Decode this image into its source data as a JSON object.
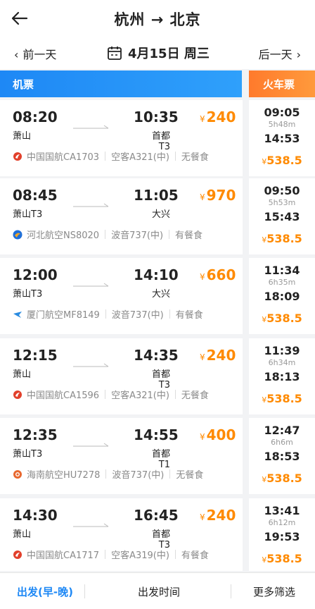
{
  "header": {
    "title": "杭州 → 北京"
  },
  "datebar": {
    "prev_label": "前一天",
    "date_label": "4月15日 周三",
    "next_label": "后一天"
  },
  "tabs": {
    "flight_label": "机票",
    "train_label": "火车票"
  },
  "rows": [
    {
      "flight": {
        "dep_time": "08:20",
        "arr_time": "10:35",
        "dep_airport": "萧山",
        "arr_airport": "首都T3",
        "price": "240",
        "airline_icon": "air-china-icon",
        "airline": "中国国航CA1703",
        "aircraft": "空客A321(中)",
        "meal": "无餐食"
      },
      "train": {
        "dep_time": "09:05",
        "duration": "5h48m",
        "arr_time": "14:53",
        "price": "538.5"
      }
    },
    {
      "flight": {
        "dep_time": "08:45",
        "arr_time": "11:05",
        "dep_airport": "萧山T3",
        "arr_airport": "大兴",
        "price": "970",
        "airline_icon": "hebei-airlines-icon",
        "airline": "河北航空NS8020",
        "aircraft": "波音737(中)",
        "meal": "有餐食"
      },
      "train": {
        "dep_time": "09:50",
        "duration": "5h53m",
        "arr_time": "15:43",
        "price": "538.5"
      }
    },
    {
      "flight": {
        "dep_time": "12:00",
        "arr_time": "14:10",
        "dep_airport": "萧山T3",
        "arr_airport": "大兴",
        "price": "660",
        "airline_icon": "xiamen-air-icon",
        "airline": "厦门航空MF8149",
        "aircraft": "波音737(中)",
        "meal": "有餐食"
      },
      "train": {
        "dep_time": "11:34",
        "duration": "6h35m",
        "arr_time": "18:09",
        "price": "538.5"
      }
    },
    {
      "flight": {
        "dep_time": "12:15",
        "arr_time": "14:35",
        "dep_airport": "萧山",
        "arr_airport": "首都T3",
        "price": "240",
        "airline_icon": "air-china-icon",
        "airline": "中国国航CA1596",
        "aircraft": "空客A321(中)",
        "meal": "无餐食"
      },
      "train": {
        "dep_time": "11:39",
        "duration": "6h34m",
        "arr_time": "18:13",
        "price": "538.5"
      }
    },
    {
      "flight": {
        "dep_time": "12:35",
        "arr_time": "14:55",
        "dep_airport": "萧山T3",
        "arr_airport": "首都T1",
        "price": "400",
        "airline_icon": "hainan-airlines-icon",
        "airline": "海南航空HU7278",
        "aircraft": "波音737(中)",
        "meal": "无餐食"
      },
      "train": {
        "dep_time": "12:47",
        "duration": "6h6m",
        "arr_time": "18:53",
        "price": "538.5"
      }
    },
    {
      "flight": {
        "dep_time": "14:30",
        "arr_time": "16:45",
        "dep_airport": "萧山",
        "arr_airport": "首都T3",
        "price": "240",
        "airline_icon": "air-china-icon",
        "airline": "中国国航CA1717",
        "aircraft": "空客A319(中)",
        "meal": "有餐食"
      },
      "train": {
        "dep_time": "13:41",
        "duration": "6h12m",
        "arr_time": "19:53",
        "price": "538.5"
      }
    }
  ],
  "currency_symbol": "¥",
  "bottom": {
    "sort_label": "出发(早-晚)",
    "time_label": "出发时间",
    "filter_label": "更多筛选"
  },
  "colors": {
    "primary_blue": "#1e88f5",
    "train_orange": "#ff8a2c",
    "price_orange": "#ff8a00"
  }
}
